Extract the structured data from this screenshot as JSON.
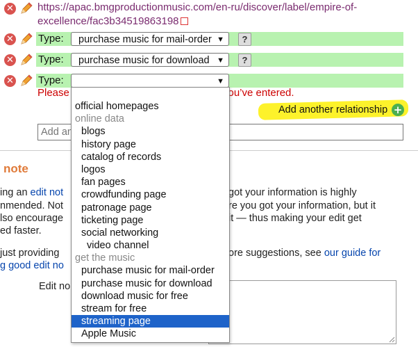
{
  "url": {
    "line1": "https://apac.bmgproductionmusic.com/en-ru/discover/label/empire-of-",
    "line2": "excellence/fac3b34519863198"
  },
  "type_label": "Type:",
  "rows": [
    {
      "selected": "purchase music for mail-order",
      "help": "?"
    },
    {
      "selected": "purchase music for download",
      "help": "?"
    },
    {
      "selected": ""
    }
  ],
  "error_text_left": "Please",
  "error_text_right": "you’ve entered.",
  "add_relationship_label": "Add another relationship",
  "add_input_placeholder": "Add an",
  "section_title": "note",
  "para": {
    "l1_a": "ing an ",
    "l1_link": "edit not",
    "l1_b": "got your information is highly",
    "l2_a": "nmended. Not",
    "l2_b": "re you got your information, but it",
    "l3_a": "lso encourage",
    "l3_b": "it — thus making your edit get",
    "l4": "ed faster.",
    "l5_a": "just providing",
    "l5_b": "ore suggestions, see ",
    "l5_link": "our guide for",
    "l6_link": "g good edit no"
  },
  "edit_note_label": "Edit no",
  "dropdown": {
    "items": [
      {
        "label": "official homepages",
        "kind": "option",
        "level": 0
      },
      {
        "label": "online data",
        "kind": "group",
        "level": 0
      },
      {
        "label": "blogs",
        "kind": "option",
        "level": 1
      },
      {
        "label": "history page",
        "kind": "option",
        "level": 1
      },
      {
        "label": "catalog of records",
        "kind": "option",
        "level": 1
      },
      {
        "label": "logos",
        "kind": "option",
        "level": 1
      },
      {
        "label": "fan pages",
        "kind": "option",
        "level": 1
      },
      {
        "label": "crowdfunding page",
        "kind": "option",
        "level": 1
      },
      {
        "label": "patronage page",
        "kind": "option",
        "level": 1
      },
      {
        "label": "ticketing page",
        "kind": "option",
        "level": 1
      },
      {
        "label": "social networking",
        "kind": "option",
        "level": 1
      },
      {
        "label": "video channel",
        "kind": "option",
        "level": 2
      },
      {
        "label": "get the music",
        "kind": "group",
        "level": 0
      },
      {
        "label": "purchase music for mail-order",
        "kind": "option",
        "level": 1
      },
      {
        "label": "purchase music for download",
        "kind": "option",
        "level": 1
      },
      {
        "label": "download music for free",
        "kind": "option",
        "level": 1
      },
      {
        "label": "stream for free",
        "kind": "option",
        "level": 1
      },
      {
        "label": "streaming page",
        "kind": "option",
        "level": 1,
        "selected": true
      },
      {
        "label": "Apple Music",
        "kind": "option",
        "level": 1
      }
    ]
  },
  "colors": {
    "row_bg": "#b8f2b0",
    "error": "#cc0000",
    "highlight": "#fdf22b",
    "selected": "#1e63c9",
    "section_title": "#e07b3a",
    "url": "#7a2b6f"
  }
}
